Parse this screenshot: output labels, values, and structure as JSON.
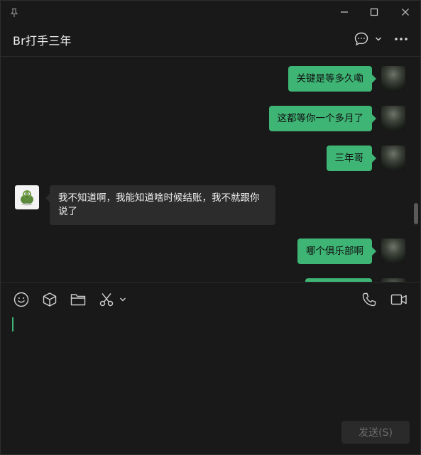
{
  "window": {
    "pin_icon": "pin-icon",
    "controls": [
      "minimize-icon",
      "maximize-icon",
      "close-icon"
    ]
  },
  "header": {
    "title": "Br打手三年",
    "icons": [
      "chat-bubble-icon",
      "chevron-down-icon",
      "more-icon"
    ]
  },
  "messages": [
    {
      "sender": "me",
      "text": "关键是等多久嘞"
    },
    {
      "sender": "me",
      "text": "这都等你一个多月了"
    },
    {
      "sender": "me",
      "text": "三年哥"
    },
    {
      "sender": "other",
      "text": "我不知道啊，我能知道啥时候结账，我不就跟你说了"
    },
    {
      "sender": "me",
      "text": "哪个俱乐部啊"
    }
  ],
  "toolbar": {
    "left_icons": [
      "emoji-icon",
      "box-icon",
      "folder-icon",
      "scissors-icon",
      "chevron-down-icon"
    ],
    "right_icons": [
      "phone-icon",
      "video-icon"
    ]
  },
  "input": {
    "value": ""
  },
  "send_button": {
    "label": "发送(S)"
  },
  "colors": {
    "background": "#191919",
    "my_bubble": "#3eb575",
    "other_bubble": "#2c2c2c",
    "accent": "#3eb575"
  }
}
